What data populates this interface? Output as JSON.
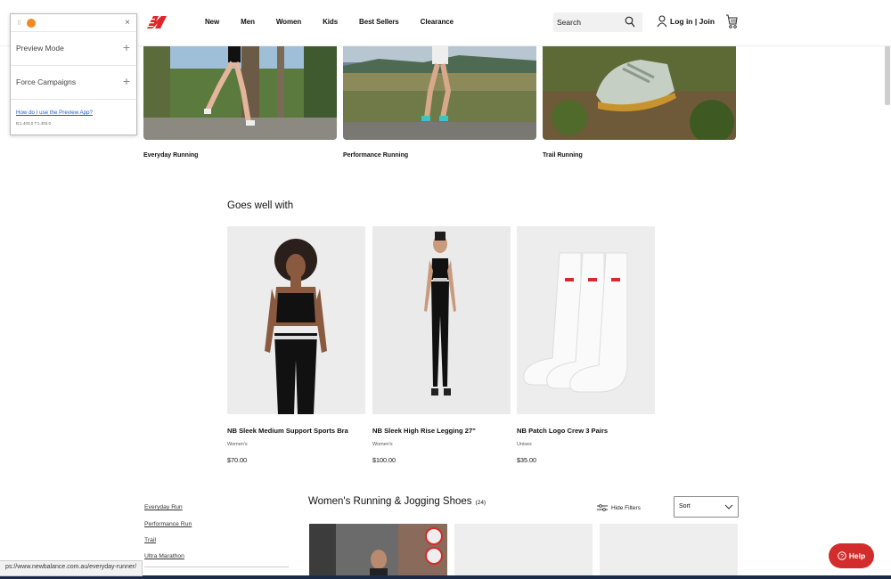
{
  "header": {
    "nav": [
      "New",
      "Men",
      "Women",
      "Kids",
      "Best Sellers",
      "Clearance"
    ],
    "search_placeholder": "Search",
    "account_label": "Log in | Join"
  },
  "hero": [
    {
      "caption": "Everyday Running"
    },
    {
      "caption": "Performance Running"
    },
    {
      "caption": "Trail Running"
    }
  ],
  "preview_panel": {
    "rows": [
      "Preview Mode",
      "Force Campaigns"
    ],
    "help_link": "How do I use the Preview App?",
    "version": "B:1.403.0 T:1.403.0"
  },
  "goes_well_with": {
    "title": "Goes well with",
    "products": [
      {
        "name": "NB Sleek Medium Support Sports Bra",
        "category": "Women's",
        "price": "$70.00"
      },
      {
        "name": "NB Sleek High Rise Legging 27\"",
        "category": "Women's",
        "price": "$100.00"
      },
      {
        "name": "NB Patch Logo Crew 3 Pairs",
        "category": "Unisex",
        "price": "$35.00"
      }
    ]
  },
  "filters": {
    "links": [
      "Everyday Run",
      "Performance Run",
      "Trail",
      "Ultra Marathon"
    ]
  },
  "listing": {
    "title": "Women's Running & Jogging Shoes",
    "count": "(24)",
    "hide_filters": "Hide Filters",
    "sort_label": "Sort"
  },
  "status_bar": {
    "url": "ps://www.newbalance.com.au/everyday-runner/"
  },
  "help_button": {
    "label": "Help"
  },
  "colors": {
    "brand_red": "#d32c2c",
    "link_blue": "#1a5fc8",
    "preview_orange": "#f08a24"
  }
}
